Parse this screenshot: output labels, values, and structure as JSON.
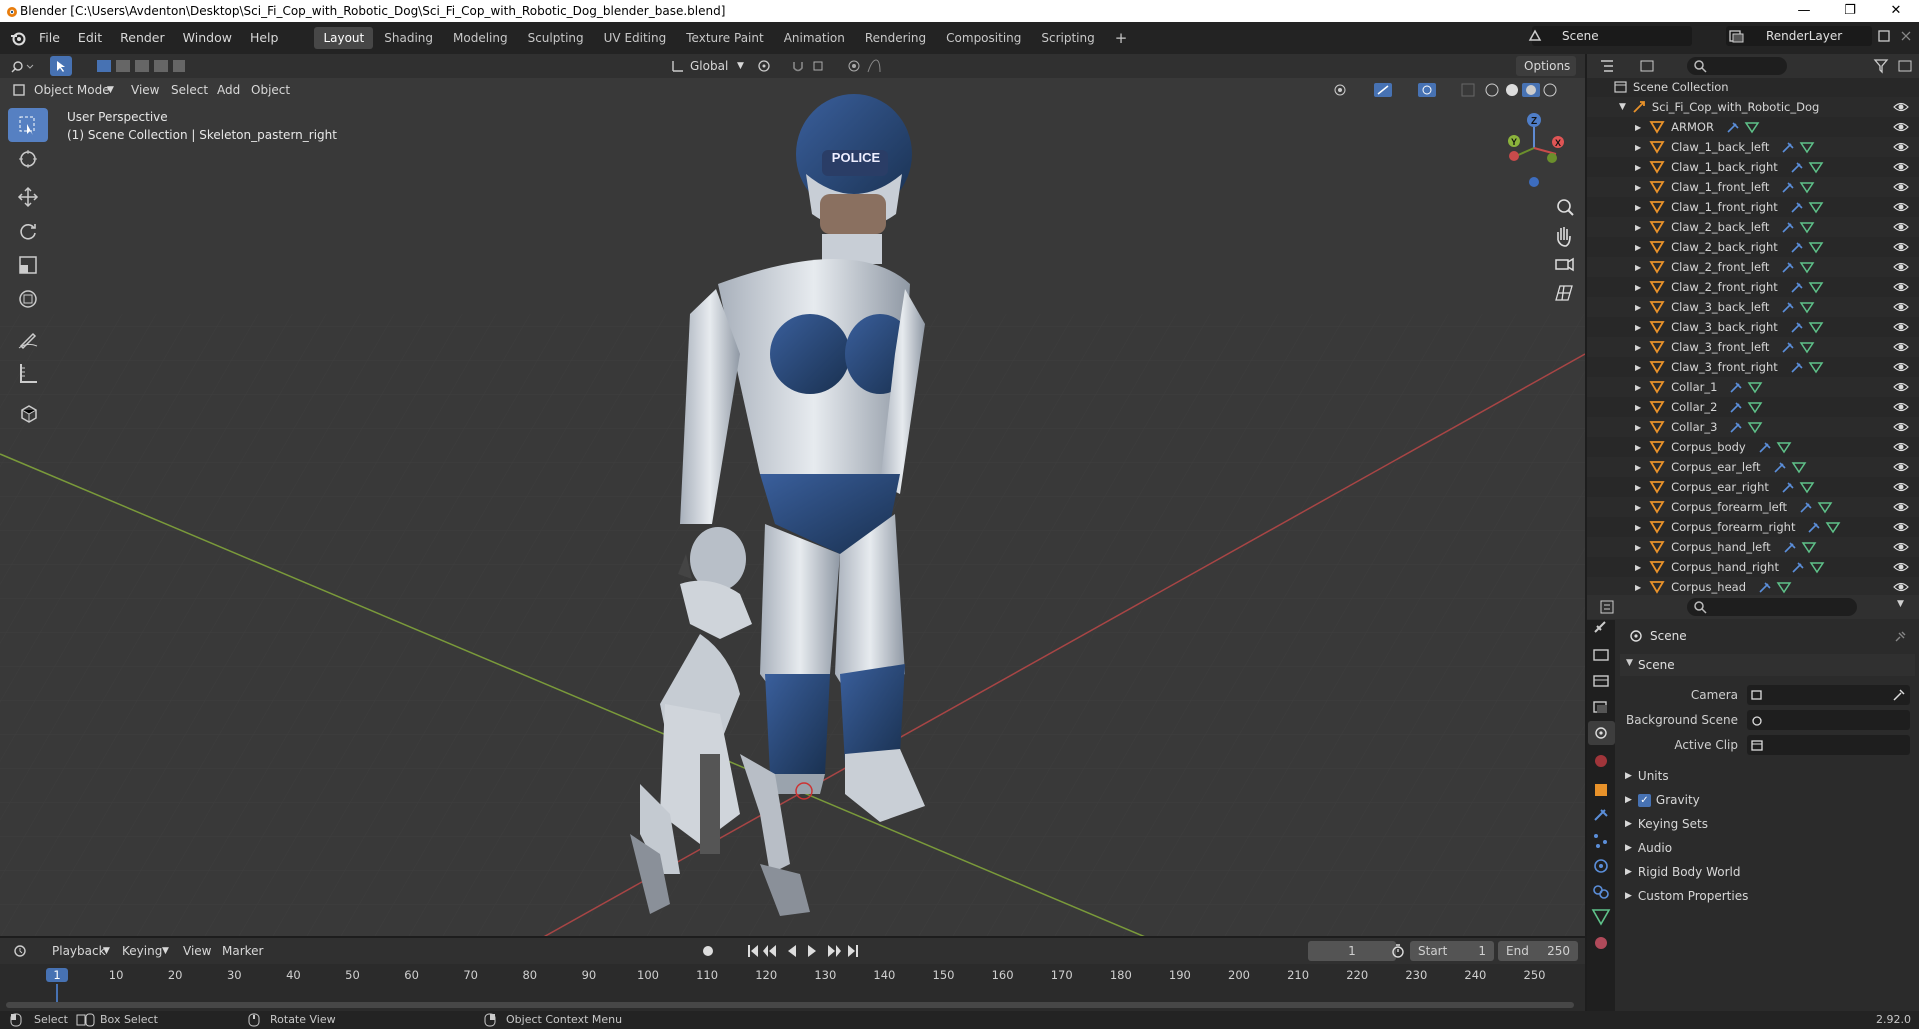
{
  "window": {
    "title": "Blender [C:\\Users\\Avdenton\\Desktop\\Sci_Fi_Cop_with_Robotic_Dog\\Sci_Fi_Cop_with_Robotic_Dog_blender_base.blend]",
    "minimize": "—",
    "maximize": "❐",
    "close": "✕"
  },
  "menu": [
    "File",
    "Edit",
    "Render",
    "Window",
    "Help"
  ],
  "workspaces": [
    "Layout",
    "Shading",
    "Modeling",
    "Sculpting",
    "UV Editing",
    "Texture Paint",
    "Animation",
    "Rendering",
    "Compositing",
    "Scripting"
  ],
  "active_workspace": "Layout",
  "add_workspace": "+",
  "scene_name": "Scene",
  "render_layer": "RenderLayer",
  "viewport": {
    "transform_orientation": "Global",
    "options_label": "Options",
    "mode": "Object Mode",
    "menus": [
      "View",
      "Select",
      "Add",
      "Object"
    ],
    "overlay_line1": "User Perspective",
    "overlay_line2": "(1) Scene Collection | Skeleton_pastern_right",
    "gizmo_z": "Z",
    "gizmo_y": "Y",
    "gizmo_x": "X",
    "police_text": "POLICE"
  },
  "outliner": {
    "root": "Scene Collection",
    "collection": "Sci_Fi_Cop_with_Robotic_Dog",
    "items": [
      "ARMOR",
      "Claw_1_back_left",
      "Claw_1_back_right",
      "Claw_1_front_left",
      "Claw_1_front_right",
      "Claw_2_back_left",
      "Claw_2_back_right",
      "Claw_2_front_left",
      "Claw_2_front_right",
      "Claw_3_back_left",
      "Claw_3_back_right",
      "Claw_3_front_left",
      "Claw_3_front_right",
      "Collar_1",
      "Collar_2",
      "Collar_3",
      "Corpus_body",
      "Corpus_ear_left",
      "Corpus_ear_right",
      "Corpus_forearm_left",
      "Corpus_forearm_right",
      "Corpus_hand_left",
      "Corpus_hand_right",
      "Corpus_head"
    ]
  },
  "properties": {
    "context": "Scene",
    "panel_title": "Scene",
    "camera_label": "Camera",
    "bg_scene_label": "Background Scene",
    "active_clip_label": "Active Clip",
    "subpanels": [
      "Units",
      "Gravity",
      "Keying Sets",
      "Audio",
      "Rigid Body World",
      "Custom Properties"
    ],
    "gravity_checked": true
  },
  "timeline": {
    "menus": [
      "Playback",
      "Keying",
      "View",
      "Marker"
    ],
    "current_frame": "1",
    "start_label": "Start",
    "start_value": "1",
    "end_label": "End",
    "end_value": "250",
    "ticks": [
      "1",
      "10",
      "20",
      "30",
      "40",
      "50",
      "60",
      "70",
      "80",
      "90",
      "100",
      "110",
      "120",
      "130",
      "140",
      "150",
      "160",
      "170",
      "180",
      "190",
      "200",
      "210",
      "220",
      "230",
      "240",
      "250"
    ]
  },
  "status": {
    "select": "Select",
    "box_select": "Box Select",
    "rotate_view": "Rotate View",
    "context_menu": "Object Context Menu",
    "version": "2.92.0"
  }
}
